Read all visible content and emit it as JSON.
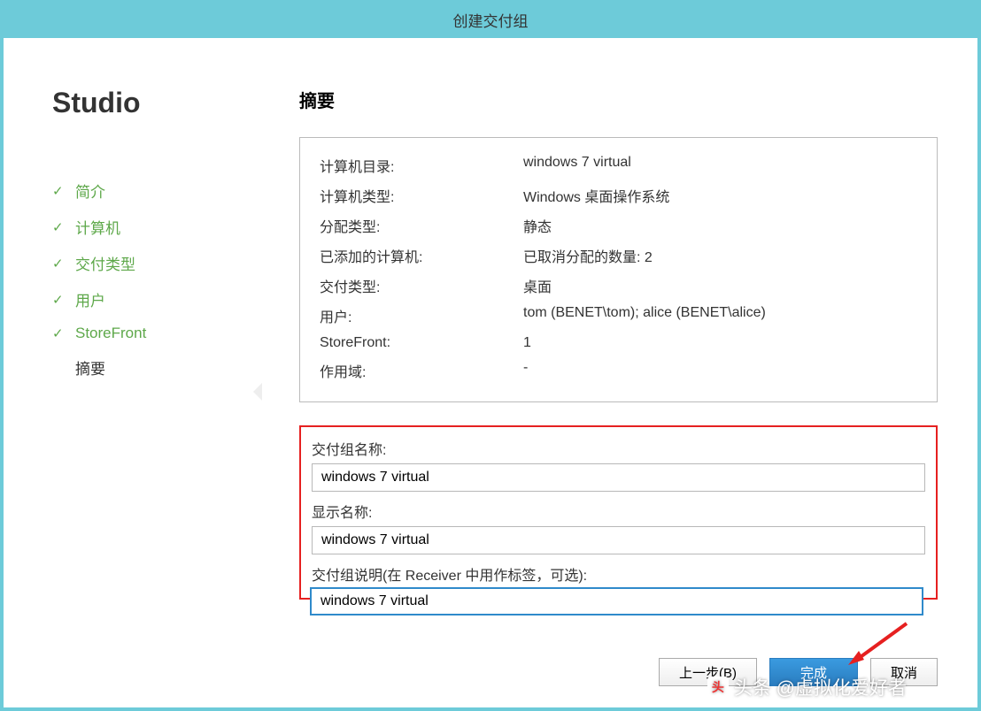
{
  "window": {
    "title": "创建交付组"
  },
  "brand": "Studio",
  "steps": [
    {
      "label": "简介",
      "state": "done"
    },
    {
      "label": "计算机",
      "state": "done"
    },
    {
      "label": "交付类型",
      "state": "done"
    },
    {
      "label": "用户",
      "state": "done"
    },
    {
      "label": "StoreFront",
      "state": "done"
    },
    {
      "label": "摘要",
      "state": "current"
    }
  ],
  "main": {
    "heading": "摘要",
    "summary": [
      {
        "k": "计算机目录:",
        "v": "windows 7 virtual"
      },
      {
        "k": "计算机类型:",
        "v": "Windows 桌面操作系统"
      },
      {
        "k": "分配类型:",
        "v": "静态"
      },
      {
        "k": "已添加的计算机:",
        "v": "已取消分配的数量: 2"
      },
      {
        "k": "交付类型:",
        "v": "桌面"
      },
      {
        "k": "用户:",
        "v": "tom (BENET\\tom); alice (BENET\\alice)"
      },
      {
        "k": "StoreFront:",
        "v": "1"
      },
      {
        "k": "作用域:",
        "v": "-"
      }
    ],
    "fields": {
      "name_label": "交付组名称:",
      "name_value": "windows 7 virtual",
      "display_label": "显示名称:",
      "display_value": "windows 7 virtual",
      "desc_label": "交付组说明(在 Receiver 中用作标签，可选):",
      "desc_value": "windows 7 virtual"
    }
  },
  "footer": {
    "back": "上一步(B)",
    "finish": "完成",
    "cancel": "取消"
  },
  "watermark": "头条 @虚拟化爱好者"
}
